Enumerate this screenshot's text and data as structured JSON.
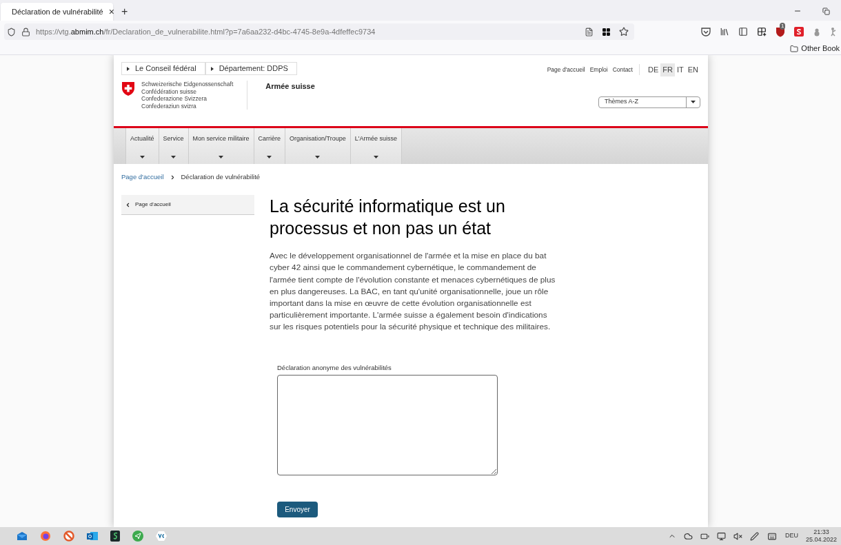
{
  "browser": {
    "tab": {
      "title": "Déclaration de vulnérabilité",
      "close": "×",
      "new_tab": "+"
    },
    "url": "https://vtg.**abmim.ch**/fr/Declaration_de_vulnerabilite.html?p=7a6aa232-d4bc-4745-8e9a-4dfeffec9734",
    "extension_badge": "1",
    "bookmark": "Other Book"
  },
  "site": {
    "top_links": [
      {
        "label": "Le Conseil fédéral"
      },
      {
        "label": "Département: DDPS"
      }
    ],
    "meta_links": [
      "Page d'accueil",
      "Emploi",
      "Contact"
    ],
    "languages": [
      {
        "label": "DE",
        "selected": false
      },
      {
        "label": "FR",
        "selected": true
      },
      {
        "label": "IT",
        "selected": false
      },
      {
        "label": "EN",
        "selected": false
      }
    ],
    "logo_lines": [
      "Schweizerische Eidgenossenschaft",
      "Confédération suisse",
      "Confederazione Svizzera",
      "Confederaziun svizra"
    ],
    "site_name": "Armée suisse",
    "themes_select": "Thèmes A-Z",
    "nav": [
      "Actualité",
      "Service",
      "Mon service militaire",
      "Carrière",
      "Organisation/Troupe",
      "L'Armée suisse"
    ],
    "breadcrumb": [
      "Page d'accueil",
      "Déclaration de vulnérabilité"
    ],
    "back_link": "Page d'accueil",
    "heading": "La sécurité informatique est un processus et non pas un état",
    "intro": "Avec le développement organisationnel de l'armée et la mise en place du bat cyber 42 ainsi que le commandement cybernétique, le commandement de l'armée tient compte de l'évolution constante et menaces cybernétiques de plus en plus dangereuses. La BAC, en tant qu'unité organisationnelle, joue un rôle important dans la mise en œuvre de cette évolution organisationnelle est particulièrement importante. L'armée suisse a également besoin d'indications sur les risques potentiels pour la sécurité physique et technique des militaires.",
    "form": {
      "label": "Déclaration anonyme des vulnérabilités",
      "submit": "Envoyer"
    }
  },
  "taskbar": {
    "language": "DEU",
    "time": "21:33",
    "date": "25.04.2022"
  }
}
